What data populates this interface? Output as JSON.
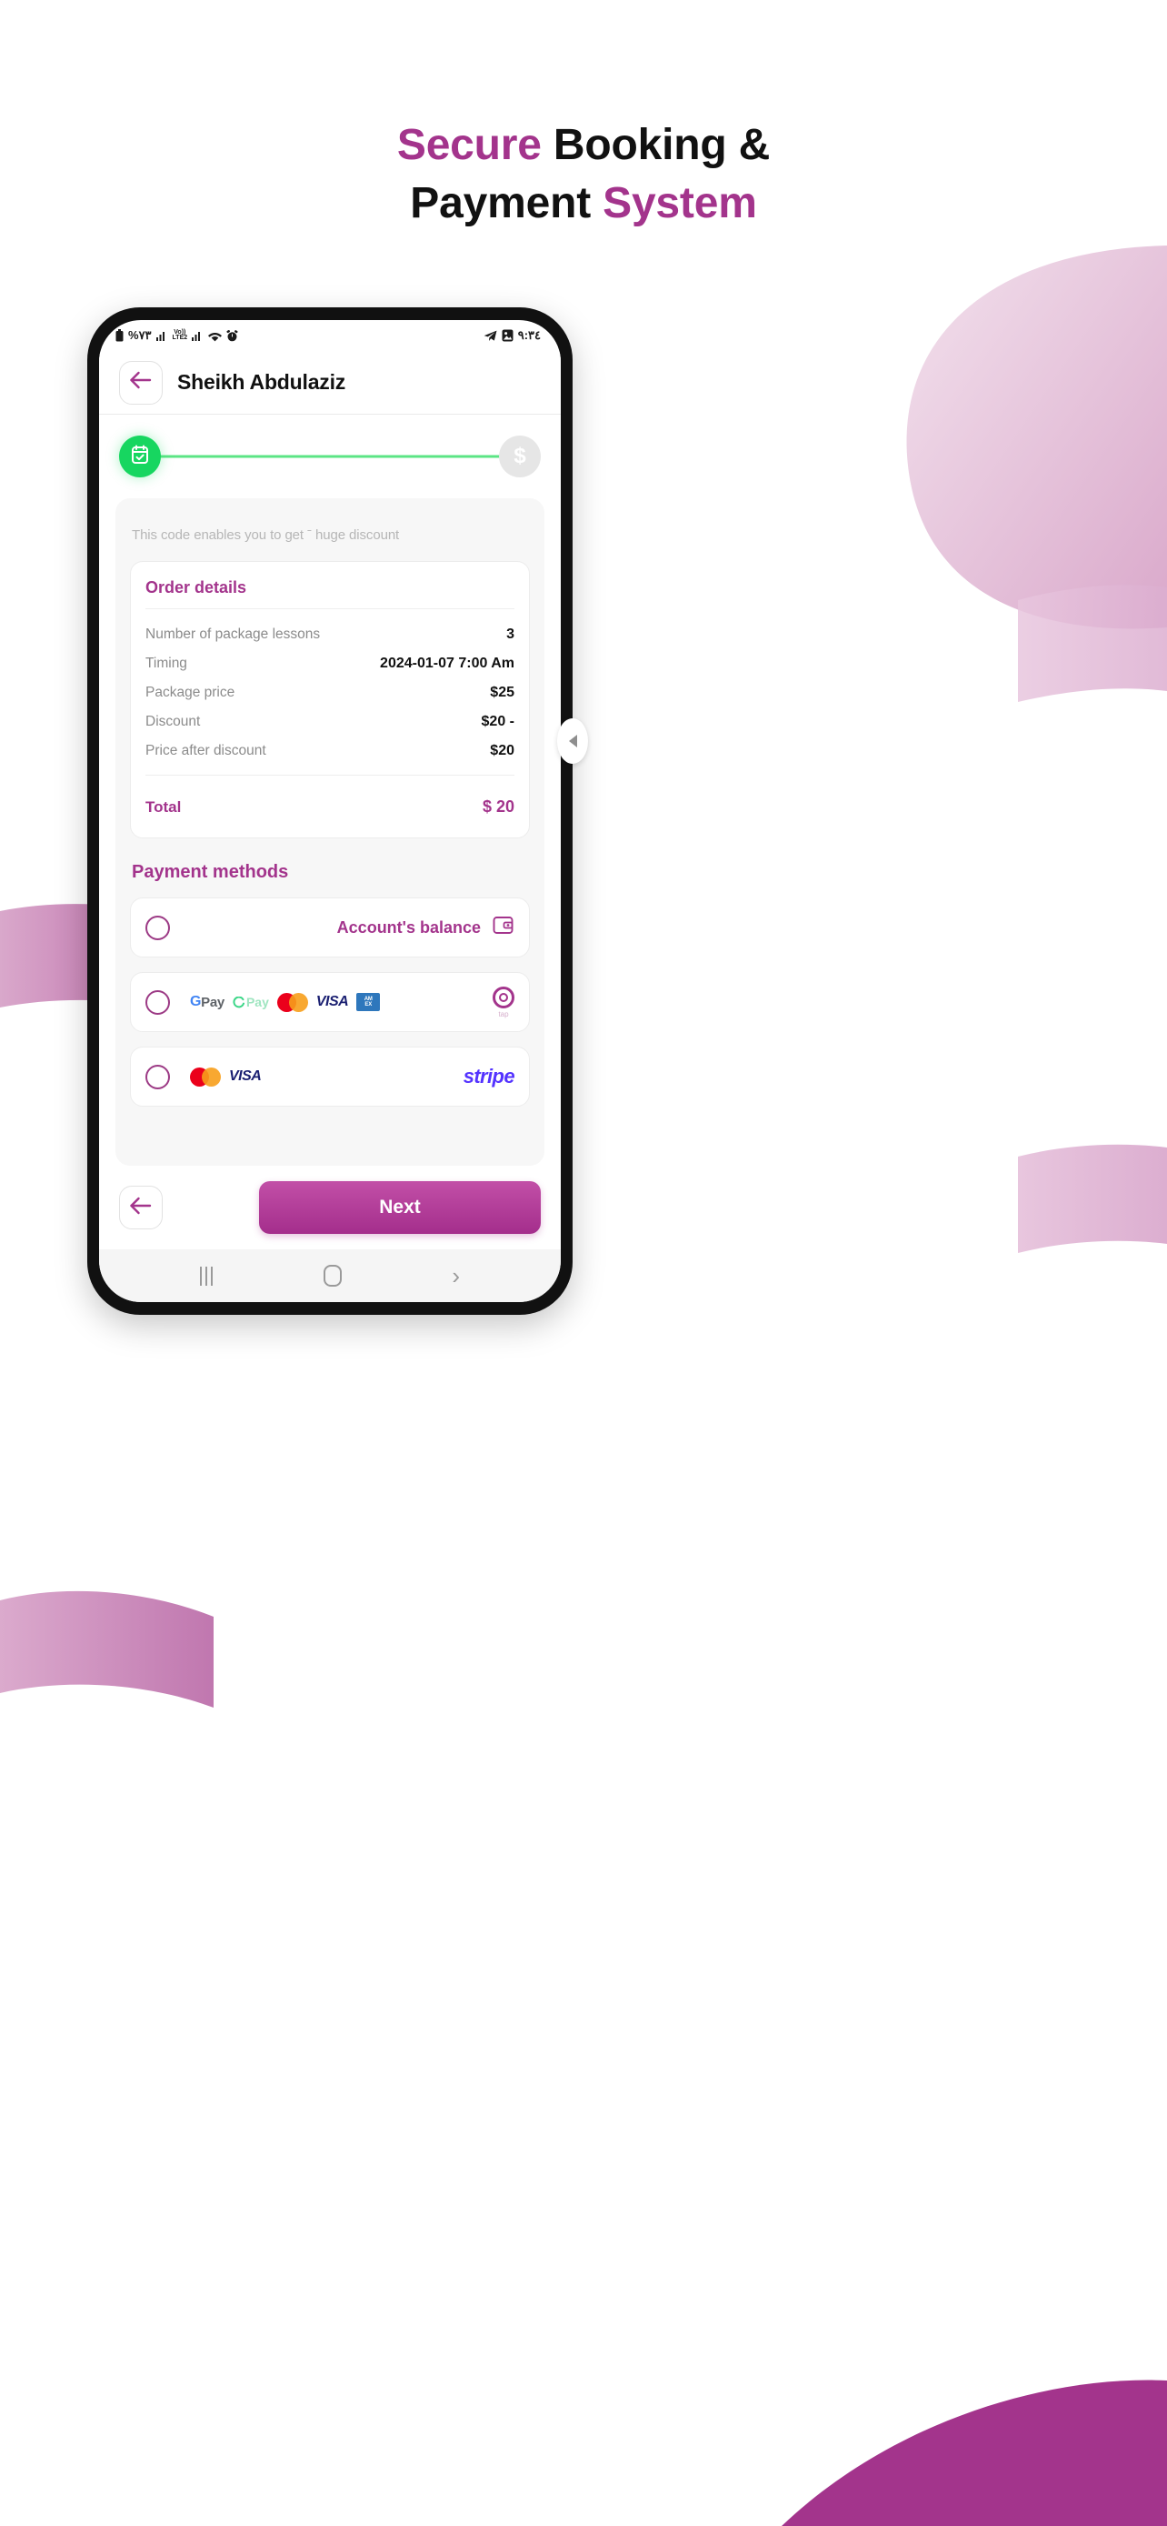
{
  "headline": {
    "line1_accent": "Secure",
    "line1_rest": " Booking &",
    "line2_rest": "Payment ",
    "line2_accent": "System"
  },
  "colors": {
    "brand_magenta": "#A3348C",
    "step_done_green": "#17D660",
    "step_track_green": "#5BE584",
    "wave_pink": "#C878B4",
    "wave_pink_light": "#E2BBD8",
    "wave_magenta_solid": "#A3348C"
  },
  "statusbar": {
    "battery_percent": "%٧٣",
    "network_label": "Vo)) LTE2",
    "vo_top": "Vo))",
    "lte_bottom": "LTE2",
    "time": "٩:٣٤",
    "icons": [
      "battery-icon",
      "signal-bars-icon",
      "volte-icon",
      "signal-bars-icon",
      "wifi-icon",
      "alarm-icon",
      "telegram-icon",
      "gallery-icon"
    ]
  },
  "appbar": {
    "back_icon": "arrow-left-icon",
    "title": "Sheikh Abdulaziz"
  },
  "stepper": {
    "step1_icon": "calendar-check-icon",
    "step1_state": "done",
    "step2_label": "$",
    "step2_state": "pending"
  },
  "promo": {
    "hint": "This code enables you to get ˉ huge discount"
  },
  "order": {
    "title": "Order details",
    "rows": [
      {
        "label": "Number of package lessons",
        "value": "3"
      },
      {
        "label": "Timing",
        "value": "2024-01-07  7:00 Am"
      },
      {
        "label": "Package price",
        "value": "$25"
      },
      {
        "label": "Discount",
        "value": "$20 -"
      },
      {
        "label": "Price after discount",
        "value": "$20"
      }
    ],
    "total_label": "Total",
    "total_value": "$ 20"
  },
  "payment": {
    "section_title": "Payment methods",
    "methods": [
      {
        "id": "account-balance",
        "label": "Account's balance",
        "icon": "wallet-icon",
        "selected": false
      },
      {
        "id": "tap",
        "label": "",
        "provider": "tap",
        "provider_text": "tap",
        "logos": [
          "gpay",
          "cpay",
          "mastercard",
          "visa",
          "amex"
        ],
        "gpay_text": "Pay",
        "gpay_g": "G",
        "cpay_text": "Pay",
        "visa_text": "VISA",
        "amex_line1": "AM",
        "amex_line2": "EX",
        "selected": false
      },
      {
        "id": "stripe",
        "label": "",
        "provider": "stripe",
        "provider_text": "stripe",
        "logos": [
          "mastercard",
          "visa"
        ],
        "visa_text": "VISA",
        "selected": false
      }
    ]
  },
  "actions": {
    "back_icon": "arrow-left-icon",
    "next_label": "Next"
  },
  "navbar": {
    "recents": "recents-icon",
    "home": "home-icon",
    "back": "back-chevron-icon",
    "back_glyph": "›"
  },
  "drawer": {
    "tab_icon": "chevron-left-icon"
  }
}
